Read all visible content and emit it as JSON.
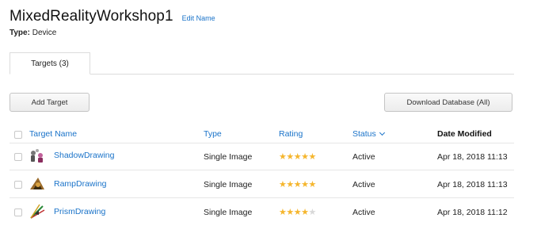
{
  "database": {
    "name": "MixedRealityWorkshop1",
    "edit_label": "Edit Name",
    "type_label": "Type:",
    "type_value": "Device"
  },
  "tabs": [
    {
      "label": "Targets (3)",
      "active": true
    }
  ],
  "actions": {
    "add_target": "Add Target",
    "download_database": "Download Database (All)"
  },
  "table": {
    "columns": {
      "name": "Target Name",
      "type": "Type",
      "rating": "Rating",
      "status": "Status",
      "date_modified": "Date Modified"
    },
    "rows": [
      {
        "name": "ShadowDrawing",
        "type": "Single Image",
        "rating": 5,
        "status": "Active",
        "date_modified": "Apr 18, 2018 11:13",
        "thumb_icon": "shadow-drawing-thumbnail"
      },
      {
        "name": "RampDrawing",
        "type": "Single Image",
        "rating": 5,
        "status": "Active",
        "date_modified": "Apr 18, 2018 11:13",
        "thumb_icon": "ramp-drawing-thumbnail"
      },
      {
        "name": "PrismDrawing",
        "type": "Single Image",
        "rating": 4,
        "status": "Active",
        "date_modified": "Apr 18, 2018 11:12",
        "thumb_icon": "prism-drawing-thumbnail"
      }
    ],
    "max_rating": 5
  },
  "colors": {
    "link": "#1a73c9",
    "star_on": "#f5b62e",
    "star_off": "#d8d8d8"
  }
}
